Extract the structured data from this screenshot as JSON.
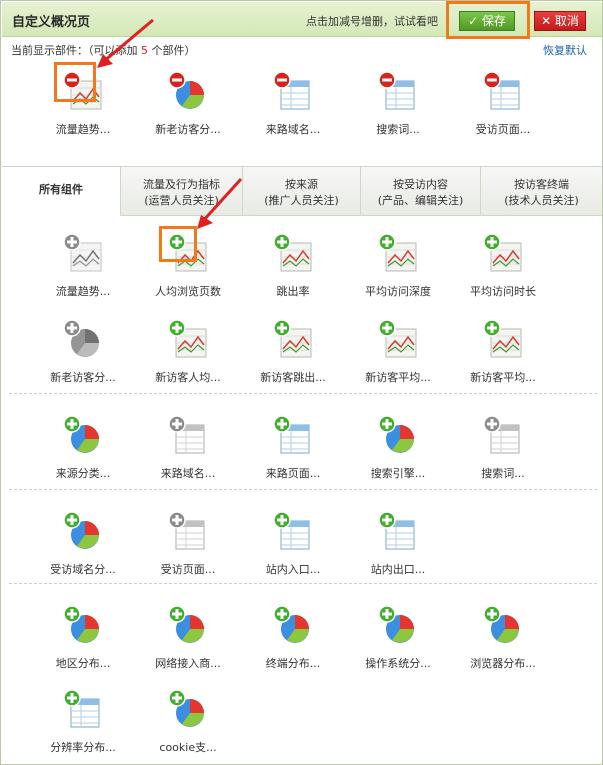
{
  "header": {
    "title": "自定义概况页",
    "hint": "点击加减号增删，试试看吧",
    "save_label": "✓ 保存",
    "cancel_label": "✕ 取消"
  },
  "current": {
    "prefix": "当前显示部件：（",
    "middle": "可以添加",
    "count": "5",
    "suffix": "个部件）",
    "restore_label": "恢复默认"
  },
  "selected_widgets": [
    {
      "label": "流量趋势...",
      "icon": "line-chart-icon"
    },
    {
      "label": "新老访客分...",
      "icon": "pie-chart-icon"
    },
    {
      "label": "来路域名...",
      "icon": "table-icon"
    },
    {
      "label": "搜索词...",
      "icon": "table-icon"
    },
    {
      "label": "受访页面...",
      "icon": "table-icon"
    }
  ],
  "tabs": [
    {
      "label": "所有组件",
      "sub": ""
    },
    {
      "label": "流量及行为指标",
      "sub": "(运营人员关注)"
    },
    {
      "label": "按来源",
      "sub": "(推广人员关注)"
    },
    {
      "label": "按受访内容",
      "sub": "(产品、编辑关注)"
    },
    {
      "label": "按访客终端",
      "sub": "(技术人员关注)"
    }
  ],
  "groups": {
    "g1": [
      {
        "label": "流量趋势...",
        "icon": "line-chart-icon",
        "state": "added"
      },
      {
        "label": "人均浏览页数",
        "icon": "line-chart-icon",
        "state": "add"
      },
      {
        "label": "跳出率",
        "icon": "line-chart-icon",
        "state": "add"
      },
      {
        "label": "平均访问深度",
        "icon": "line-chart-icon",
        "state": "add"
      },
      {
        "label": "平均访问时长",
        "icon": "line-chart-icon",
        "state": "add"
      },
      {
        "label": "新老访客分...",
        "icon": "pie-chart-icon",
        "state": "added"
      },
      {
        "label": "新访客人均...",
        "icon": "line-chart-icon",
        "state": "add"
      },
      {
        "label": "新访客跳出...",
        "icon": "line-chart-icon",
        "state": "add"
      },
      {
        "label": "新访客平均...",
        "icon": "line-chart-icon",
        "state": "add"
      },
      {
        "label": "新访客平均...",
        "icon": "line-chart-icon",
        "state": "add"
      }
    ],
    "g2": [
      {
        "label": "来源分类...",
        "icon": "pie-chart-icon",
        "state": "add"
      },
      {
        "label": "来路域名...",
        "icon": "table-icon",
        "state": "added"
      },
      {
        "label": "来路页面...",
        "icon": "table-icon",
        "state": "add"
      },
      {
        "label": "搜索引擎...",
        "icon": "pie-chart-icon",
        "state": "add"
      },
      {
        "label": "搜索词...",
        "icon": "table-icon",
        "state": "added"
      }
    ],
    "g3": [
      {
        "label": "受访域名分...",
        "icon": "pie-chart-icon",
        "state": "add"
      },
      {
        "label": "受访页面...",
        "icon": "table-icon",
        "state": "added"
      },
      {
        "label": "站内入口...",
        "icon": "table-icon",
        "state": "add"
      },
      {
        "label": "站内出口...",
        "icon": "table-icon",
        "state": "add"
      }
    ],
    "g4": [
      {
        "label": "地区分布...",
        "icon": "pie-chart-icon",
        "state": "add"
      },
      {
        "label": "网络接入商...",
        "icon": "pie-chart-icon",
        "state": "add"
      },
      {
        "label": "终端分布...",
        "icon": "pie-chart-icon",
        "state": "add"
      },
      {
        "label": "操作系统分...",
        "icon": "pie-chart-icon",
        "state": "add"
      },
      {
        "label": "浏览器分布...",
        "icon": "pie-chart-icon",
        "state": "add"
      },
      {
        "label": "分辨率分布...",
        "icon": "table-icon",
        "state": "add"
      },
      {
        "label": "cookie支...",
        "icon": "pie-chart-icon",
        "state": "add"
      }
    ]
  },
  "colors": {
    "accent_green": "#4f9a24",
    "cancel_red": "#c31a1a",
    "highlight_orange": "#f07a1a",
    "arrow_red": "#e02020"
  }
}
